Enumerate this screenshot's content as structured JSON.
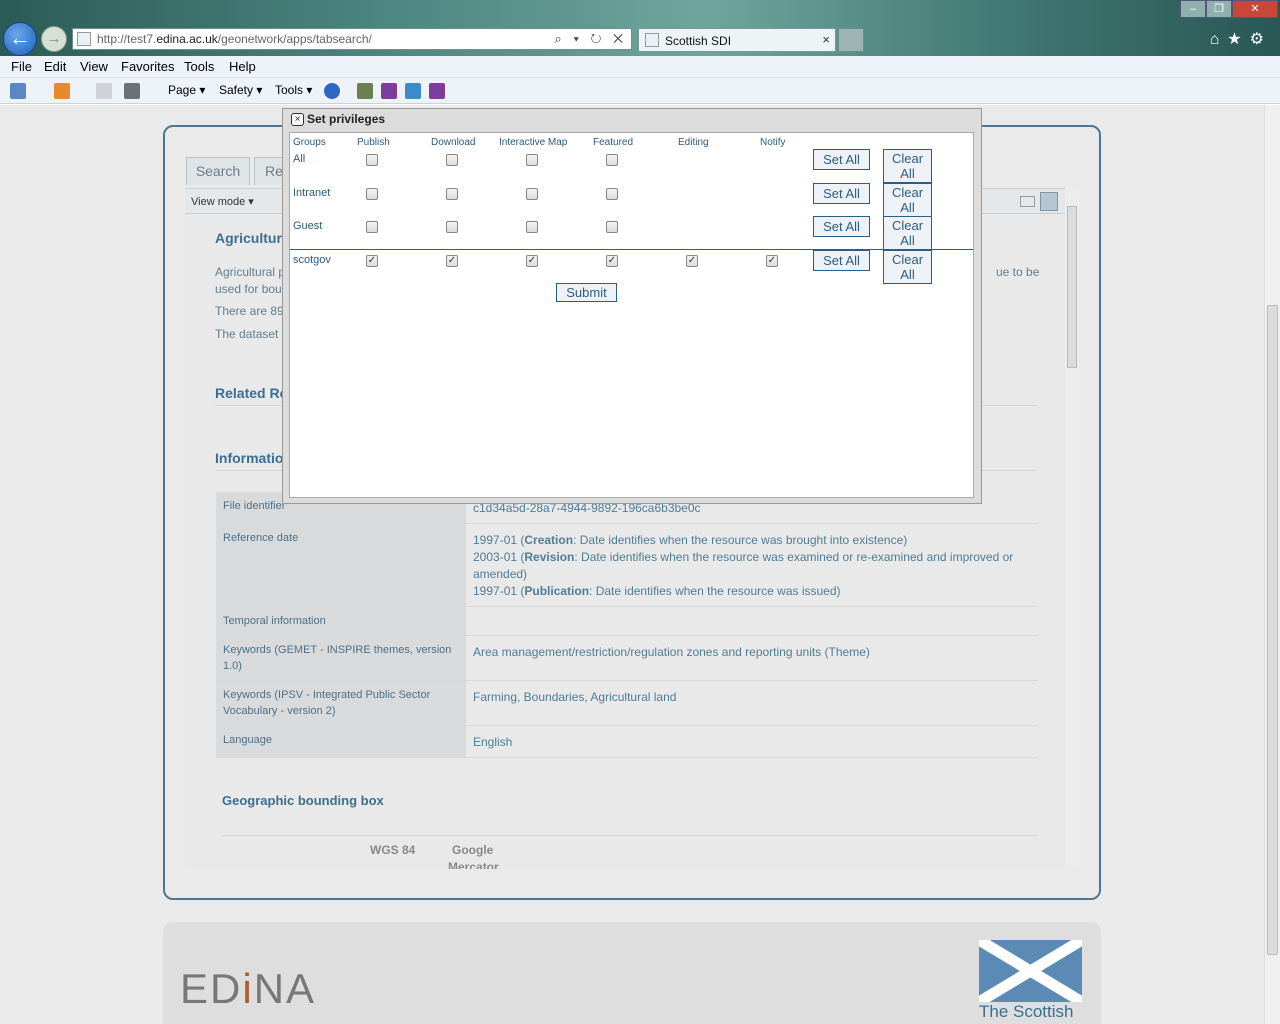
{
  "browser": {
    "url_prefix": "http://test7.",
    "url_domain": "edina.ac.uk",
    "url_path": "/geonetwork/apps/tabsearch/",
    "tab_title": "Scottish SDI",
    "addr_tools": "⌕ ▾ ↻ ✕",
    "back_glyph": "←",
    "fwd_glyph": "→",
    "tab_close_glyph": "×",
    "win_min": "–",
    "win_max": "❐",
    "win_close": "✕",
    "right_icons": "⌂★⚙"
  },
  "menu": [
    "File",
    "Edit",
    "View",
    "Favorites",
    "Tools",
    "Help"
  ],
  "commandbar": {
    "page": "Page ▾",
    "safety": "Safety ▾",
    "tools": "Tools ▾"
  },
  "search_tabs": [
    "Search",
    "Re"
  ],
  "view_mode": "View mode ▾",
  "record": {
    "title": "Agricultur",
    "para1_a": "Agricultural p",
    "para1_b": "used for bou",
    "para1_tail": "ue to be",
    "para2": "There are 89",
    "para3": "The dataset",
    "related": "Related Re",
    "info": "Information"
  },
  "info_table": [
    {
      "key": "File identifier",
      "value": "c1d34a5d-28a7-4944-9892-196ca6b3be0c"
    },
    {
      "key": "Reference date",
      "lines": [
        {
          "date": "1997-01 (",
          "type": "Creation",
          "desc": ": Date identifies when the resource was brought into existence)"
        },
        {
          "date": "2003-01 (",
          "type": "Revision",
          "desc": ": Date identifies when the resource was examined or re-examined and improved or amended)"
        },
        {
          "date": "1997-01 (",
          "type": "Publication",
          "desc": ": Date identifies when the resource was issued)"
        }
      ]
    },
    {
      "key": "Temporal information",
      "value": ""
    },
    {
      "key": "Keywords (GEMET - INSPIRE themes, version 1.0)",
      "value": "Area management/restriction/regulation zones and reporting units (Theme)"
    },
    {
      "key": "Keywords (IPSV - Integrated Public Sector Vocabulary - version 2)",
      "value": "Farming, Boundaries, Agricultural land"
    },
    {
      "key": "Language",
      "value": "English"
    }
  ],
  "geo": {
    "heading": "Geographic bounding box",
    "wgs": "WGS 84",
    "google": "Google",
    "mercator": "Mercator"
  },
  "footer": {
    "edina_pre": "ED",
    "edina_i": "i",
    "edina_post": "NA",
    "scottish": "The Scottish"
  },
  "dialog": {
    "title": "Set privileges",
    "close": "×",
    "columns": [
      "Groups",
      "Publish",
      "Download",
      "Interactive Map",
      "Featured",
      "Editing",
      "Notify"
    ],
    "groups": [
      {
        "name": "All",
        "checks": [
          false,
          false,
          false,
          false
        ]
      },
      {
        "name": "Intranet",
        "checks": [
          false,
          false,
          false,
          false
        ]
      },
      {
        "name": "Guest",
        "checks": [
          false,
          false,
          false,
          false
        ]
      },
      {
        "name": "scotgov",
        "checks": [
          true,
          true,
          true,
          true,
          true,
          true
        ]
      }
    ],
    "set_all": "Set All",
    "clear_all": "Clear All",
    "submit": "Submit"
  }
}
